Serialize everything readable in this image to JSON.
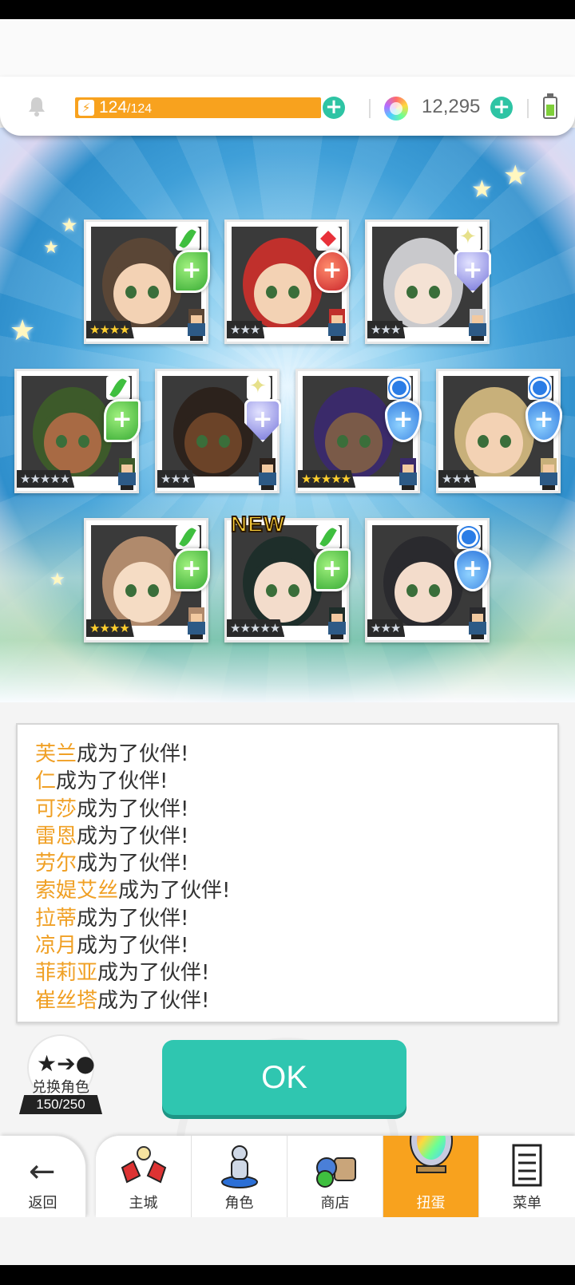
{
  "hud": {
    "stamina_current": "124",
    "stamina_max": "/124",
    "gems": "12,295",
    "colors": {
      "stamina": "#f8a21e",
      "plus": "#2ec4a4"
    }
  },
  "cards": [
    {
      "new": false,
      "element": "leaf",
      "rarity": "4",
      "stars": "★★★★",
      "star_color": "gold"
    },
    {
      "new": false,
      "element": "fire",
      "rarity": "3",
      "stars": "★★★",
      "star_color": "silver"
    },
    {
      "new": false,
      "element": "light",
      "rarity": "3",
      "stars": "★★★",
      "star_color": "silver"
    },
    {
      "new": false,
      "element": "leaf",
      "rarity": "5",
      "stars": "★★★★★",
      "star_color": "silver"
    },
    {
      "new": false,
      "element": "light",
      "rarity": "3",
      "stars": "★★★",
      "star_color": "silver"
    },
    {
      "new": false,
      "element": "water",
      "rarity": "5",
      "stars": "★★★★★",
      "star_color": "gold"
    },
    {
      "new": false,
      "element": "water",
      "rarity": "3",
      "stars": "★★★",
      "star_color": "silver"
    },
    {
      "new": false,
      "element": "leaf",
      "rarity": "4",
      "stars": "★★★★",
      "star_color": "gold"
    },
    {
      "new": true,
      "element": "leaf",
      "rarity": "5",
      "stars": "★★★★★",
      "star_color": "silver",
      "new_label": "NEW"
    },
    {
      "new": false,
      "element": "water",
      "rarity": "3",
      "stars": "★★★",
      "star_color": "silver"
    }
  ],
  "log": {
    "suffix": "成为了伙伴!",
    "names": [
      "芙兰",
      "仁",
      "可莎",
      "雷恩",
      "劳尔",
      "索媞艾丝",
      "拉蒂",
      "凉月",
      "菲莉亚",
      "崔丝塔"
    ]
  },
  "exchange": {
    "label": "兑换角色",
    "count": "150/250"
  },
  "ok_button": "OK",
  "nav": {
    "back": "返回",
    "items": [
      {
        "label": "主城",
        "active": false
      },
      {
        "label": "角色",
        "active": false
      },
      {
        "label": "商店",
        "active": false
      },
      {
        "label": "扭蛋",
        "active": true
      },
      {
        "label": "菜单",
        "active": false
      }
    ]
  }
}
